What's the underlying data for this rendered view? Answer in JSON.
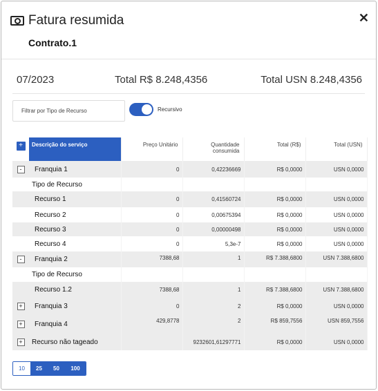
{
  "dialog": {
    "title": "Fatura resumida",
    "close_label": "✕",
    "contract": "Contrato.1",
    "period": "07/2023",
    "total_brl": "Total R$ 8.248,4356",
    "total_usn": "Total USN 8.248,4356"
  },
  "filter": {
    "placeholder": "Filtrar por Tipo de Recurso",
    "toggle_label": "Recursivo",
    "toggle_on": true
  },
  "table": {
    "columns": [
      "Descrição do serviço",
      "Preço Unitário",
      "Quantidade consumida",
      "Total (R$)",
      "Total (USN)"
    ],
    "rows": [
      {
        "kind": "group",
        "expander": "-",
        "desc": "Franquia 1",
        "price": "0",
        "qty": "0,42236669",
        "brl": "R$ 0,0000",
        "usn": "USN 0,0000"
      },
      {
        "kind": "sublabel",
        "desc": "Tipo de Recurso"
      },
      {
        "kind": "item",
        "desc": "Recurso 1",
        "price": "0",
        "qty": "0,41560724",
        "brl": "R$ 0,0000",
        "usn": "USN 0,0000"
      },
      {
        "kind": "item",
        "desc": "Recurso 2",
        "price": "0",
        "qty": "0,00675394",
        "brl": "R$ 0,0000",
        "usn": "USN 0,0000"
      },
      {
        "kind": "item",
        "desc": "Recurso 3",
        "price": "0",
        "qty": "0,00000498",
        "brl": "R$ 0,0000",
        "usn": "USN 0,0000"
      },
      {
        "kind": "item",
        "desc": "Recurso 4",
        "price": "0",
        "qty": "5,3e-7",
        "brl": "R$ 0,0000",
        "usn": "USN 0,0000"
      },
      {
        "kind": "group",
        "expander": "-",
        "desc": "Franquia 2",
        "price": "7388,68",
        "qty": "1",
        "brl": "R$ 7.388,6800",
        "usn": "USN 7.388,6800"
      },
      {
        "kind": "sublabel",
        "desc": "Tipo de Recurso"
      },
      {
        "kind": "item",
        "desc": "Recurso 1.2",
        "price": "7388,68",
        "qty": "1",
        "brl": "R$ 7.388,6800",
        "usn": "USN 7.388,6800"
      },
      {
        "kind": "group",
        "expander": "+",
        "desc": "Franquia 3",
        "price": "0",
        "qty": "2",
        "brl": "R$ 0,0000",
        "usn": "USN 0,0000"
      },
      {
        "kind": "group",
        "expander": "+",
        "desc": "Franquia 4",
        "price": "429,8778",
        "qty": "2",
        "brl": "R$ 859,7556",
        "usn": "USN 859,7556"
      },
      {
        "kind": "group-small",
        "expander": "+",
        "desc": "Recurso não tageado",
        "price": "",
        "qty": "9232601,61297771",
        "brl": "R$ 0,0000",
        "usn": "USN 0,0000"
      }
    ]
  },
  "pager": {
    "options": [
      "10",
      "25",
      "50",
      "100"
    ],
    "active": "10"
  },
  "colors": {
    "accent": "#2c5fc0",
    "row_gray": "#ececec"
  }
}
